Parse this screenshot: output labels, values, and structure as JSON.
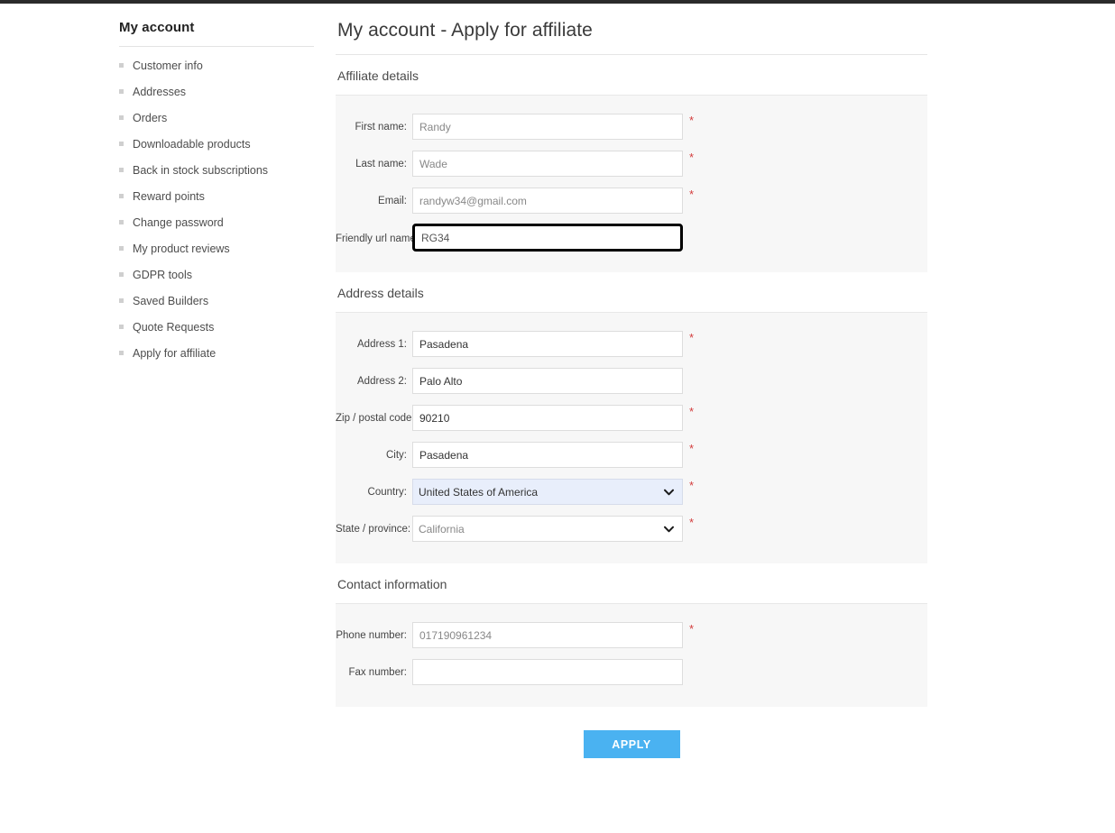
{
  "top_bar": {
    "color": "#2b2b2b"
  },
  "sidebar": {
    "title": "My account",
    "items": [
      {
        "label": "Customer info"
      },
      {
        "label": "Addresses"
      },
      {
        "label": "Orders"
      },
      {
        "label": "Downloadable products"
      },
      {
        "label": "Back in stock subscriptions"
      },
      {
        "label": "Reward points"
      },
      {
        "label": "Change password"
      },
      {
        "label": "My product reviews"
      },
      {
        "label": "GDPR tools"
      },
      {
        "label": "Saved Builders"
      },
      {
        "label": "Quote Requests"
      },
      {
        "label": "Apply for affiliate"
      }
    ]
  },
  "main": {
    "page_title": "My account - Apply for affiliate",
    "sections": {
      "affiliate": {
        "title": "Affiliate details",
        "fields": {
          "first_name": {
            "label": "First name:",
            "value": "Randy",
            "required": "*"
          },
          "last_name": {
            "label": "Last name:",
            "value": "Wade",
            "required": "*"
          },
          "email": {
            "label": "Email:",
            "value": "randyw34@gmail.com",
            "required": "*"
          },
          "friendly_url": {
            "label": "Friendly url name",
            "value": "RG34"
          }
        }
      },
      "address": {
        "title": "Address details",
        "fields": {
          "address1": {
            "label": "Address 1:",
            "value": "Pasadena",
            "required": "*"
          },
          "address2": {
            "label": "Address 2:",
            "value": "Palo Alto"
          },
          "zip": {
            "label": "Zip / postal code:",
            "value": "90210",
            "required": "*"
          },
          "city": {
            "label": "City:",
            "value": "Pasadena",
            "required": "*"
          },
          "country": {
            "label": "Country:",
            "value": "United States of America",
            "required": "*"
          },
          "state": {
            "label": "State / province:",
            "value": "California",
            "required": "*"
          }
        }
      },
      "contact": {
        "title": "Contact information",
        "fields": {
          "phone": {
            "label": "Phone number:",
            "value": "017190961234",
            "required": "*"
          },
          "fax": {
            "label": "Fax number:",
            "value": ""
          }
        }
      }
    },
    "submit": {
      "label": "APPLY",
      "color": "#4ab2f1"
    }
  }
}
